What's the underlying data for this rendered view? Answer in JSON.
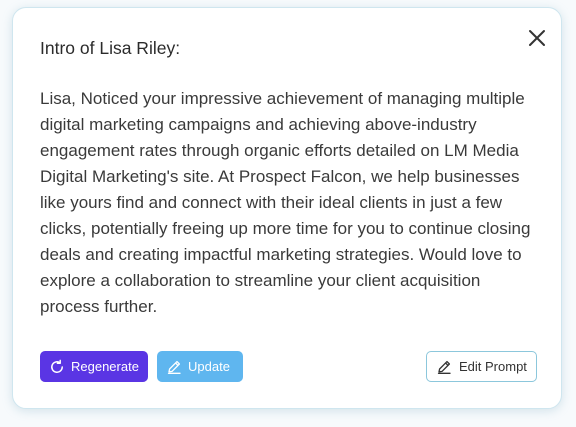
{
  "dialog": {
    "title": "Intro of Lisa Riley:",
    "message": "Lisa, Noticed your impressive achievement of managing multiple digital marketing campaigns and achieving above-industry engagement rates through organic efforts detailed on LM Media Digital Marketing's site. At Prospect Falcon, we help businesses like yours find and connect with their ideal clients in just a few clicks, potentially freeing up more time for you to continue closing deals and creating impactful marketing strategies. Would love to explore a collaboration to streamline your client acquisition process further.",
    "close_icon": "close-icon"
  },
  "actions": {
    "regenerate_label": "Regenerate",
    "regenerate_icon": "refresh-icon",
    "update_label": "Update",
    "update_icon": "pencil-icon",
    "edit_prompt_label": "Edit Prompt",
    "edit_prompt_icon": "pencil-icon"
  },
  "colors": {
    "regenerate_bg": "#5a35e4",
    "update_bg": "#5fb6ef",
    "edit_border": "#8cc7dc",
    "card_border": "#cfe6ef"
  }
}
